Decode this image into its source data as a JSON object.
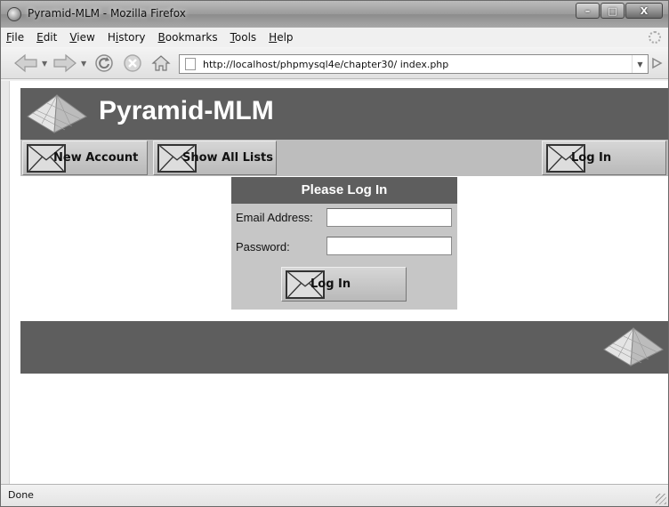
{
  "window": {
    "title": "Pyramid-MLM - Mozilla Firefox",
    "controls": [
      "–",
      "□",
      "X"
    ]
  },
  "menu": {
    "items": [
      {
        "letter": "F",
        "rest": "ile"
      },
      {
        "letter": "E",
        "rest": "dit"
      },
      {
        "letter": "V",
        "rest": "iew"
      },
      {
        "letter": "",
        "rest": "History",
        "underline_index": 1
      },
      {
        "letter": "B",
        "rest": "ookmarks"
      },
      {
        "letter": "T",
        "rest": "ools"
      },
      {
        "letter": "H",
        "rest": "elp"
      }
    ]
  },
  "toolbar": {
    "back_icon": "back-arrow-icon",
    "forward_icon": "forward-arrow-icon",
    "reload_icon": "reload-icon",
    "stop_icon": "stop-icon",
    "home_icon": "home-icon",
    "url": "http://localhost/phpmysql4e/chapter30/ index.php"
  },
  "site": {
    "title": "Pyramid-MLM",
    "nav": {
      "new_account": "New Account",
      "show_all_lists": "Show All Lists",
      "log_in": "Log In"
    },
    "login": {
      "heading": "Please Log In",
      "email_label": "Email Address:",
      "email_value": "",
      "password_label": "Password:",
      "password_value": "",
      "submit": "Log In"
    }
  },
  "status": {
    "text": "Done"
  },
  "colors": {
    "header_bg": "#5e5e5e",
    "nav_bg": "#bdbdbd",
    "login_bg": "#c6c6c6"
  }
}
